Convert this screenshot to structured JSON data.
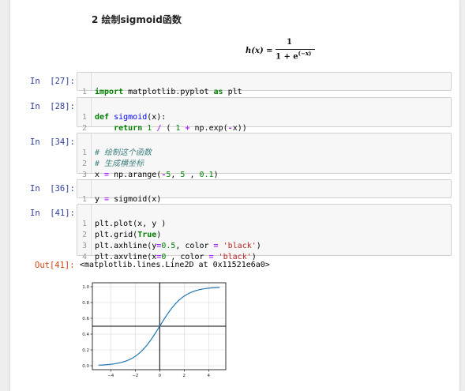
{
  "markdown": {
    "heading": "2  绘制sigmoid函数"
  },
  "formula": {
    "lhs": "h(x) =",
    "numerator": "1",
    "denominator_base": "1 + e",
    "denominator_exp": "(−x)"
  },
  "cells": [
    {
      "prompt": "In  [27]:",
      "lines": [
        "import matplotlib.pyplot as plt"
      ]
    },
    {
      "prompt": "In  [28]:",
      "lines": [
        "def sigmoid(x):",
        "    return 1 / ( 1 + np.exp(-x))"
      ]
    },
    {
      "prompt": "In  [34]:",
      "lines": [
        "# 绘制这个函数",
        "# 生成横坐标",
        "x = np.arange(-5, 5 , 0.1)"
      ]
    },
    {
      "prompt": "In  [36]:",
      "lines": [
        "y = sigmoid(x)"
      ]
    },
    {
      "prompt": "In  [41]:",
      "lines": [
        "plt.plot(x, y )",
        "plt.grid(True)",
        "plt.axhline(y=0.5, color = 'black')",
        "plt.axvline(x=0 , color = 'black')"
      ]
    }
  ],
  "output": {
    "prompt": "Out[41]:",
    "text": "<matplotlib.lines.Line2D at 0x11521e6a0>"
  },
  "colors": {
    "prompt_in": "#303f9f",
    "prompt_out": "#d84315",
    "curve": "#1f77b4"
  },
  "chart_data": {
    "type": "line",
    "function": "sigmoid",
    "x_range": [
      -5,
      4.9
    ],
    "x_step": 0.1,
    "xlim": [
      -5.5,
      5.4
    ],
    "ylim": [
      -0.05,
      1.05
    ],
    "xticks": [
      "−4",
      "−2",
      "0",
      "2",
      "4"
    ],
    "xtick_values": [
      -4,
      -2,
      0,
      2,
      4
    ],
    "yticks": [
      "0.0",
      "0.2",
      "0.4",
      "0.6",
      "0.8",
      "1.0"
    ],
    "ytick_values": [
      0.0,
      0.2,
      0.4,
      0.6,
      0.8,
      1.0
    ],
    "grid": true,
    "hline_y": 0.5,
    "vline_x": 0
  }
}
